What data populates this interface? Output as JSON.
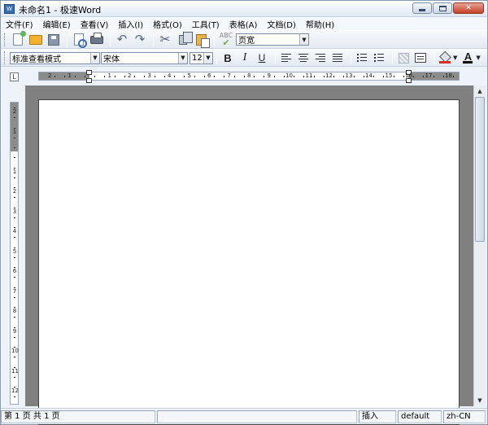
{
  "window": {
    "title": "未命名1 - 极速Word",
    "icon_text": "W"
  },
  "menu": [
    {
      "label": "文件(F)"
    },
    {
      "label": "编辑(E)"
    },
    {
      "label": "查看(V)"
    },
    {
      "label": "插入(I)"
    },
    {
      "label": "格式(O)"
    },
    {
      "label": "工具(T)"
    },
    {
      "label": "表格(A)"
    },
    {
      "label": "文档(D)"
    },
    {
      "label": "帮助(H)"
    }
  ],
  "toolbar": {
    "spell_label": "ABC",
    "zoom_value": "页宽"
  },
  "format_toolbar": {
    "style_value": "标准查看模式",
    "font_value": "宋体",
    "size_value": "12",
    "bold_label": "B",
    "italic_label": "I",
    "underline_label": "U",
    "font_color_label": "A",
    "fill_color": "#d93025",
    "font_color": "#000000"
  },
  "ruler": {
    "corner_label": "L",
    "h_left_numbers": [
      "2",
      "1"
    ],
    "h_numbers": [
      "1",
      "2",
      "3",
      "4",
      "5",
      "6",
      "7",
      "8",
      "9",
      "10",
      "11",
      "12",
      "13",
      "14",
      "15",
      "16",
      "17",
      "18"
    ],
    "v_top_numbers": [
      "2",
      "1"
    ],
    "v_numbers": [
      "1",
      "2",
      "3",
      "4",
      "5",
      "6",
      "7",
      "8",
      "9",
      "10",
      "11",
      "12"
    ]
  },
  "status": {
    "page_info": "第 1 页  共 1 页",
    "mode": "插入",
    "style": "default",
    "lang": "zh-CN"
  }
}
